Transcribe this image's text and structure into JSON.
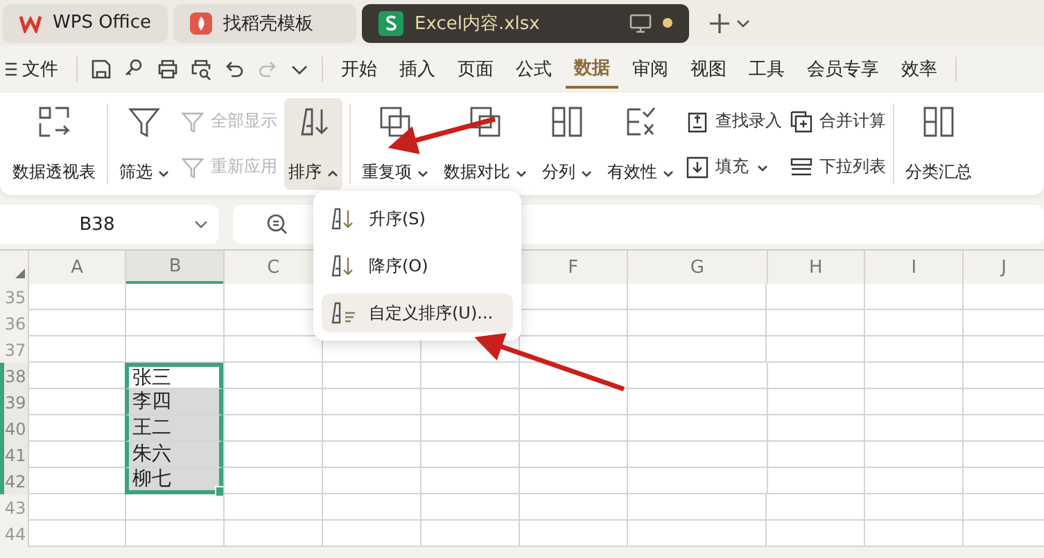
{
  "tabs": [
    {
      "label": "WPS Office",
      "selected": false,
      "unsaved": false
    },
    {
      "label": "找稻壳模板",
      "selected": false,
      "unsaved": false
    },
    {
      "label": "Excel内容.xlsx",
      "selected": true,
      "unsaved": true
    }
  ],
  "menu": {
    "file": "文件",
    "tabs": [
      {
        "label": "开始",
        "selected": false
      },
      {
        "label": "插入",
        "selected": false
      },
      {
        "label": "页面",
        "selected": false
      },
      {
        "label": "公式",
        "selected": false
      },
      {
        "label": "数据",
        "selected": true
      },
      {
        "label": "审阅",
        "selected": false
      },
      {
        "label": "视图",
        "selected": false
      },
      {
        "label": "工具",
        "selected": false
      },
      {
        "label": "会员专享",
        "selected": false
      },
      {
        "label": "效率",
        "selected": false
      }
    ]
  },
  "ribbon": {
    "groups": [
      [
        {
          "kind": "large",
          "label": "数据透视表",
          "dropdown": false,
          "pressed": false
        }
      ],
      [
        {
          "kind": "large",
          "label": "筛选",
          "dropdown": true,
          "pressed": false
        },
        {
          "kind": "stack",
          "items": [
            {
              "label": "全部显示",
              "disabled": true,
              "dropdown": false
            },
            {
              "label": "重新应用",
              "disabled": true,
              "dropdown": false
            }
          ]
        },
        {
          "kind": "large",
          "label": "排序",
          "dropdown": true,
          "pressed": true
        }
      ],
      [
        {
          "kind": "large",
          "label": "重复项",
          "dropdown": true,
          "pressed": false
        },
        {
          "kind": "large",
          "label": "数据对比",
          "dropdown": true,
          "pressed": false
        },
        {
          "kind": "large",
          "label": "分列",
          "dropdown": true,
          "pressed": false
        },
        {
          "kind": "large",
          "label": "有效性",
          "dropdown": true,
          "pressed": false
        },
        {
          "kind": "stack",
          "items": [
            {
              "label": "查找录入",
              "disabled": false,
              "dropdown": false
            },
            {
              "label": "填充",
              "disabled": false,
              "dropdown": true
            }
          ]
        },
        {
          "kind": "stack",
          "items": [
            {
              "label": "合并计算",
              "disabled": false,
              "dropdown": false
            },
            {
              "label": "下拉列表",
              "disabled": false,
              "dropdown": false
            }
          ]
        }
      ],
      [
        {
          "kind": "large",
          "label": "分类汇总",
          "dropdown": false,
          "pressed": false
        }
      ]
    ]
  },
  "name_box": "B38",
  "sort_menu": {
    "items": [
      {
        "label": "升序(S)",
        "highlighted": false
      },
      {
        "label": "降序(O)",
        "highlighted": false
      },
      {
        "label": "自定义排序(U)...",
        "highlighted": true
      }
    ]
  },
  "sheet": {
    "columns": [
      {
        "label": "A",
        "selected": false
      },
      {
        "label": "B",
        "selected": true
      },
      {
        "label": "C",
        "selected": false
      },
      {
        "label": "F",
        "selected": false
      },
      {
        "label": "G",
        "selected": false
      },
      {
        "label": "H",
        "selected": false
      },
      {
        "label": "I",
        "selected": false
      },
      {
        "label": "J",
        "selected": false
      }
    ],
    "rows": [
      {
        "number": "35",
        "selected": false
      },
      {
        "number": "36",
        "selected": false
      },
      {
        "number": "37",
        "selected": false
      },
      {
        "number": "38",
        "selected": true,
        "value": "张三",
        "shaded": false
      },
      {
        "number": "39",
        "selected": true,
        "value": "李四",
        "shaded": true
      },
      {
        "number": "40",
        "selected": true,
        "value": "王二",
        "shaded": true
      },
      {
        "number": "41",
        "selected": true,
        "value": "朱六",
        "shaded": true
      },
      {
        "number": "42",
        "selected": true,
        "value": "柳七",
        "shaded": true
      },
      {
        "number": "43",
        "selected": false
      },
      {
        "number": "44",
        "selected": false
      }
    ]
  }
}
